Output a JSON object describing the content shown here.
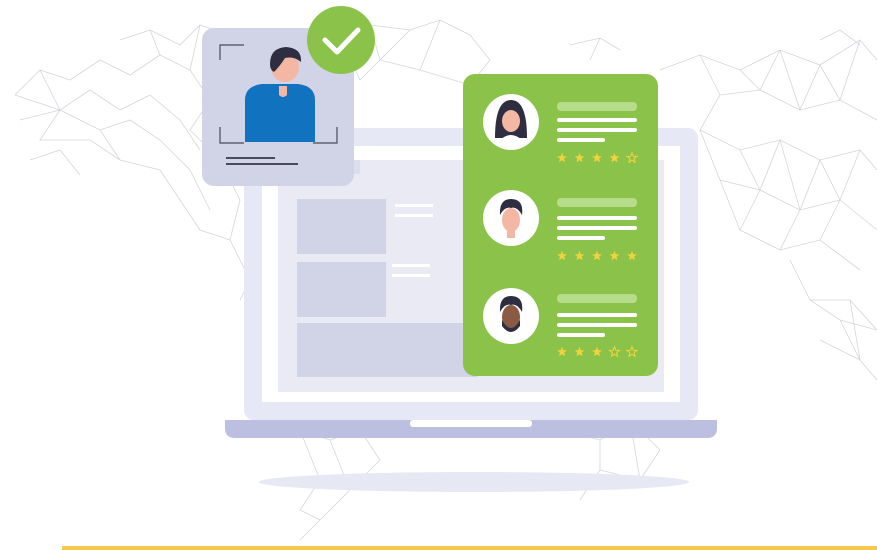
{
  "illustration": {
    "profile_card": {
      "verified_icon": "check-icon",
      "person_icon": "person-silhouette-icon"
    },
    "reviews": [
      {
        "avatar": "woman-avatar-icon",
        "rating": 4,
        "max": 5
      },
      {
        "avatar": "man-avatar-icon",
        "rating": 5,
        "max": 5
      },
      {
        "avatar": "bearded-man-avatar-icon",
        "rating": 3,
        "max": 5
      }
    ],
    "colors": {
      "accent_green": "#8bc34a",
      "card_bg": "#d1d4e6",
      "star": "#f2d33b",
      "shirt": "#1172bf",
      "laptop_base": "#bdbfe0",
      "screen_frame": "#e6e8f5"
    }
  }
}
